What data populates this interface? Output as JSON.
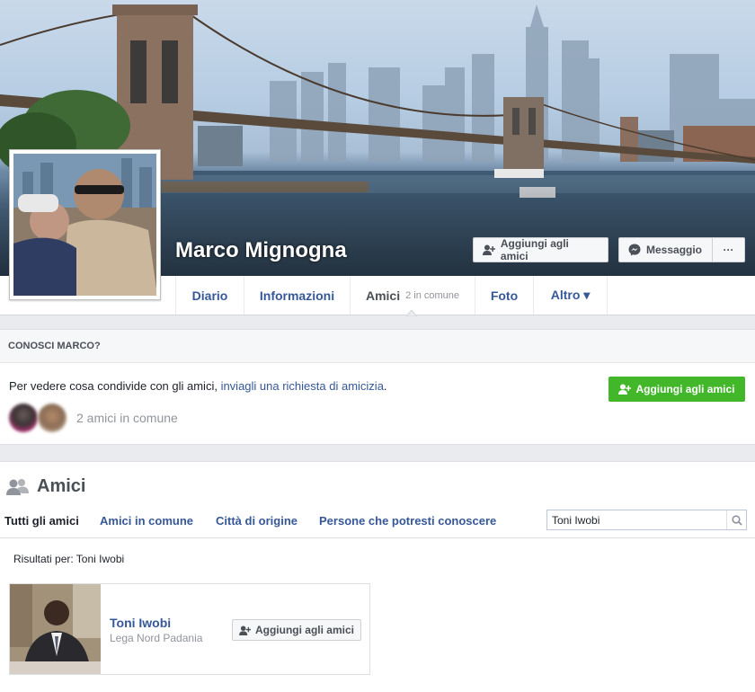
{
  "profile": {
    "name": "Marco Mignogna",
    "add_friend_label": "Aggiungi agli amici",
    "message_label": "Messaggio",
    "more_label": "···"
  },
  "nav": {
    "items": [
      {
        "label": "Diario"
      },
      {
        "label": "Informazioni"
      },
      {
        "label": "Amici",
        "sub": "2 in comune"
      },
      {
        "label": "Foto"
      },
      {
        "label": "Altro ▾"
      }
    ]
  },
  "know": {
    "title": "CONOSCI MARCO?",
    "text": "Per vedere cosa condivide con gli amici, ",
    "link": "inviagli una richiesta di amicizia",
    "text_end": ".",
    "button_label": "Aggiungi agli amici",
    "mutual": "2 amici in comune"
  },
  "friends": {
    "title": "Amici",
    "tabs": [
      {
        "label": "Tutti gli amici"
      },
      {
        "label": "Amici in comune"
      },
      {
        "label": "Città di origine"
      },
      {
        "label": "Persone che potresti conoscere"
      }
    ],
    "search_value": "Toni Iwobi",
    "results_label": "Risultati per: Toni Iwobi",
    "result": {
      "name": "Toni Iwobi",
      "subtitle": "Lega Nord Padania",
      "button_label": "Aggiungi agli amici"
    }
  },
  "colors": {
    "link": "#365899",
    "green": "#42b72a",
    "muted": "#90949c"
  }
}
